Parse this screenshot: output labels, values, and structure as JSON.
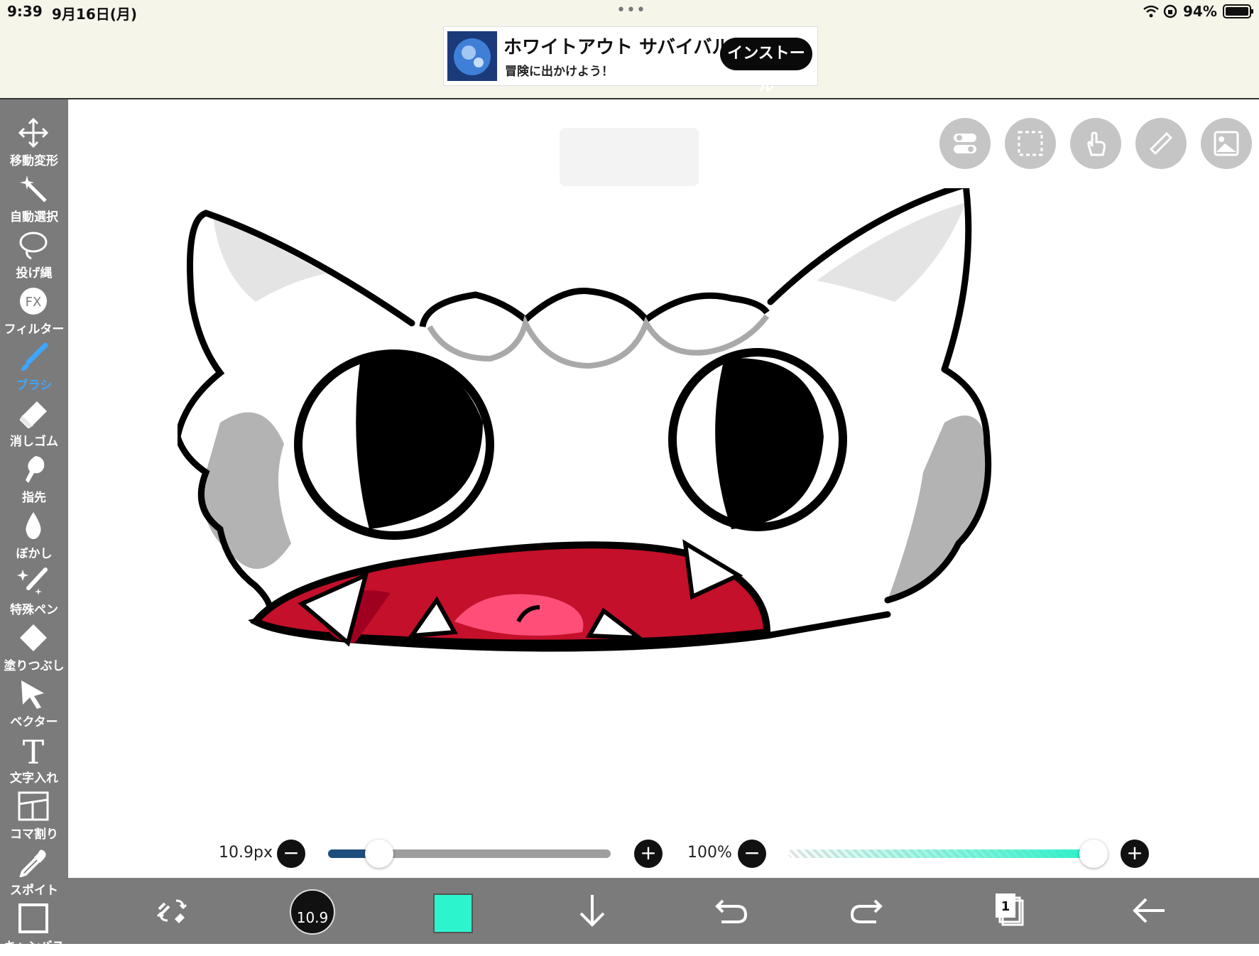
{
  "status_bar": {
    "time": "9:39",
    "date": "9月16日(月)",
    "battery": "94%",
    "icons": [
      "wifi-icon",
      "rotation-lock-icon",
      "battery-icon"
    ]
  },
  "ad": {
    "title": "ホワイトアウト サバイバル",
    "subtitle": "冒険に出かけよう！",
    "button": "インストール"
  },
  "toolbar": {
    "items": [
      {
        "label": "移動変形",
        "icon": "move-icon"
      },
      {
        "label": "自動選択",
        "icon": "magic-wand-icon"
      },
      {
        "label": "投げ縄",
        "icon": "lasso-icon"
      },
      {
        "label": "フィルター",
        "icon": "fx-icon",
        "icon_text": "FX"
      },
      {
        "label": "ブラシ",
        "icon": "brush-icon",
        "active": true
      },
      {
        "label": "消しゴム",
        "icon": "eraser-icon"
      },
      {
        "label": "指先",
        "icon": "finger-icon"
      },
      {
        "label": "ぼかし",
        "icon": "blur-drop-icon"
      },
      {
        "label": "特殊ペン",
        "icon": "special-pen-icon"
      },
      {
        "label": "塗りつぶし",
        "icon": "fill-icon"
      },
      {
        "label": "ベクター",
        "icon": "vector-cursor-icon"
      },
      {
        "label": "文字入れ",
        "icon": "text-icon",
        "icon_text": "T"
      },
      {
        "label": "コマ割り",
        "icon": "panel-icon"
      },
      {
        "label": "スポイト",
        "icon": "eyedropper-icon"
      },
      {
        "label": "キャンバス",
        "icon": "canvas-icon"
      }
    ]
  },
  "canvas_buttons": [
    "toggle-icon",
    "selection-icon",
    "hand-icon",
    "ruler-icon",
    "image-icon"
  ],
  "brush": {
    "size_label": "10.9px",
    "size_badge": "10.9",
    "size_fraction": 0.18,
    "opacity_label": "100%",
    "opacity_fraction": 1.0
  },
  "colors": {
    "accent": "#3ea6ff",
    "current_color": "#2cf4cd",
    "toolbar_bg": "#7b7b7b"
  },
  "bottom_bar": {
    "items": [
      "swap-tools-icon",
      "brush-size-indicator",
      "color-chip",
      "save-down-icon",
      "undo-icon",
      "redo-icon",
      "layers-icon",
      "back-icon"
    ],
    "layer_count": "1"
  }
}
